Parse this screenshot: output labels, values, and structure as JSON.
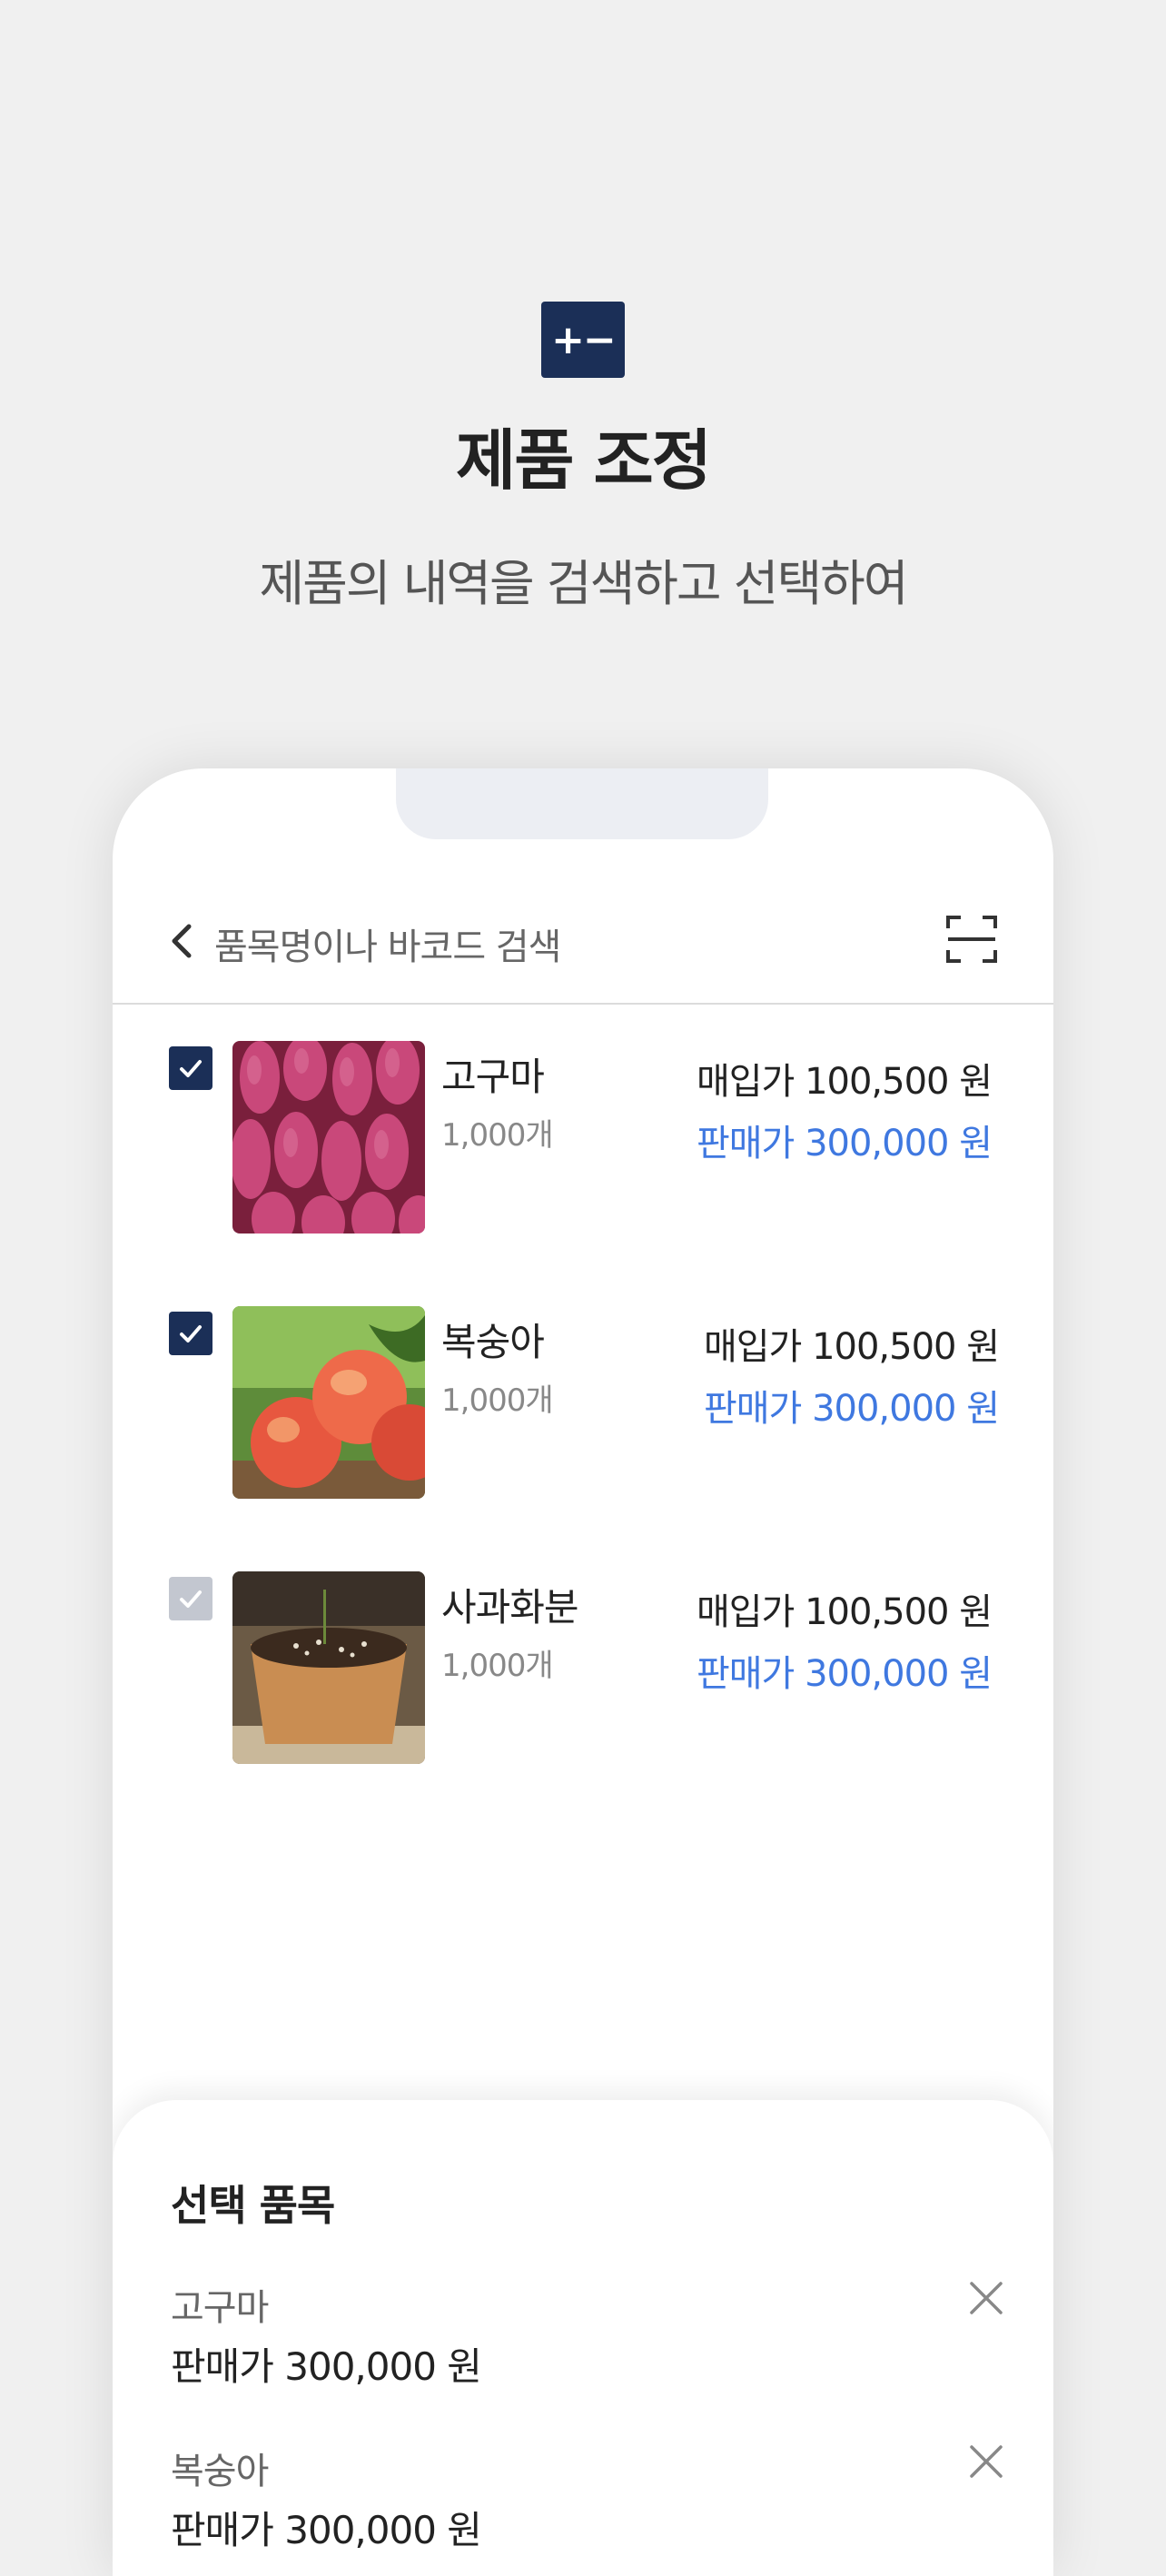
{
  "header": {
    "icon_label": "+−",
    "title": "제품 조정",
    "subtitle": "제품의 내역을 검색하고 선택하여"
  },
  "search": {
    "placeholder": "품목명이나 바코드 검색"
  },
  "products": [
    {
      "name": "고구마",
      "qty": "1,000개",
      "buy": "매입가 100,500 원",
      "sell": "판매가 300,000 원",
      "checked": true,
      "image": "sweet-potato"
    },
    {
      "name": "복숭아",
      "qty": "1,000개",
      "buy": "매입가 100,500 원",
      "sell": "판매가 300,000 원",
      "checked": true,
      "image": "peach"
    },
    {
      "name": "사과화분",
      "qty": "1,000개",
      "buy": "매입가 100,500 원",
      "sell": "판매가 300,000 원",
      "checked": false,
      "image": "apple-pot"
    }
  ],
  "selected": {
    "title": "선택 품목",
    "items": [
      {
        "name": "고구마",
        "price": "판매가 300,000 원"
      },
      {
        "name": "복숭아",
        "price": "판매가 300,000 원"
      }
    ]
  },
  "colors": {
    "navy": "#1b2f57",
    "accent_blue": "#3f78e0",
    "background": "#f0f0f0"
  }
}
